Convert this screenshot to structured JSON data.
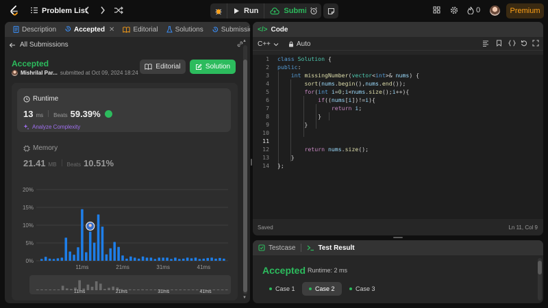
{
  "topbar": {
    "problem_list_label": "Problem List",
    "run_label": "Run",
    "submit_label": "Submit",
    "streak_count": "0",
    "premium_label": "Premium"
  },
  "left_tabs": [
    {
      "label": "Description"
    },
    {
      "label": "Accepted"
    },
    {
      "label": "Editorial"
    },
    {
      "label": "Solutions"
    },
    {
      "label": "Submissions"
    }
  ],
  "submission": {
    "back_label": "All Submissions",
    "status": "Accepted",
    "author": "Mishrilal Par...",
    "submitted_text": "submitted at Oct 09, 2024 18:24",
    "editorial_button": "Editorial",
    "solution_button": "Solution"
  },
  "runtime": {
    "label": "Runtime",
    "value": "13",
    "unit": "ms",
    "beats_label": "Beats",
    "beats_value": "59.39%",
    "analyze_label": "Analyze Complexity"
  },
  "memory": {
    "label": "Memory",
    "value": "21.41",
    "unit": "MB",
    "beats_label": "Beats",
    "beats_value": "10.51%"
  },
  "chart_data": {
    "type": "bar",
    "y_ticks": [
      "20%",
      "15%",
      "10%",
      "5%",
      "0%"
    ],
    "ylim": [
      0,
      20
    ],
    "x_labels": [
      {
        "label": "11ms",
        "index": 10
      },
      {
        "label": "21ms",
        "index": 20
      },
      {
        "label": "31ms",
        "index": 30
      },
      {
        "label": "41ms",
        "index": 40
      }
    ],
    "values": [
      0.5,
      1.1,
      0.6,
      0.5,
      0.7,
      0.9,
      6.5,
      2.6,
      1.7,
      3.8,
      14.5,
      2.4,
      8.2,
      5.1,
      13.0,
      9.6,
      1.8,
      3.5,
      5.3,
      3.9,
      1.5,
      0.6,
      1.2,
      0.9,
      0.6,
      1.2,
      0.9,
      0.9,
      0.5,
      0.9,
      0.9,
      0.9,
      0.5,
      0.9,
      0.5,
      0.6,
      0.9,
      0.7,
      0.9,
      0.5,
      0.6,
      0.8,
      0.9,
      0.6,
      0.8,
      0.6
    ],
    "highlight_index": 12,
    "bar_color": "#1e7ee8"
  },
  "mini_chart": {
    "x_labels": [
      "11ms",
      "21ms",
      "31ms",
      "41ms"
    ]
  },
  "code": {
    "header_label": "Code",
    "language": "C++",
    "mode": "Auto",
    "status": "Saved",
    "cursor": "Ln 11, Col 9",
    "line_numbers": [
      "1",
      "2",
      "3",
      "4",
      "5",
      "6",
      "7",
      "8",
      "9",
      "10",
      "11",
      "12",
      "13",
      "14"
    ]
  },
  "result": {
    "testcase_tab": "Testcase",
    "result_tab": "Test Result",
    "status": "Accepted",
    "runtime_text": "Runtime: 2 ms",
    "cases": [
      "Case 1",
      "Case 2",
      "Case 3"
    ],
    "active_case": 1
  },
  "colors": {
    "accent_green": "#2cbb5d",
    "brand_orange": "#ffa116",
    "panel_bg": "#262626",
    "page_bg": "#0f0f0f"
  }
}
